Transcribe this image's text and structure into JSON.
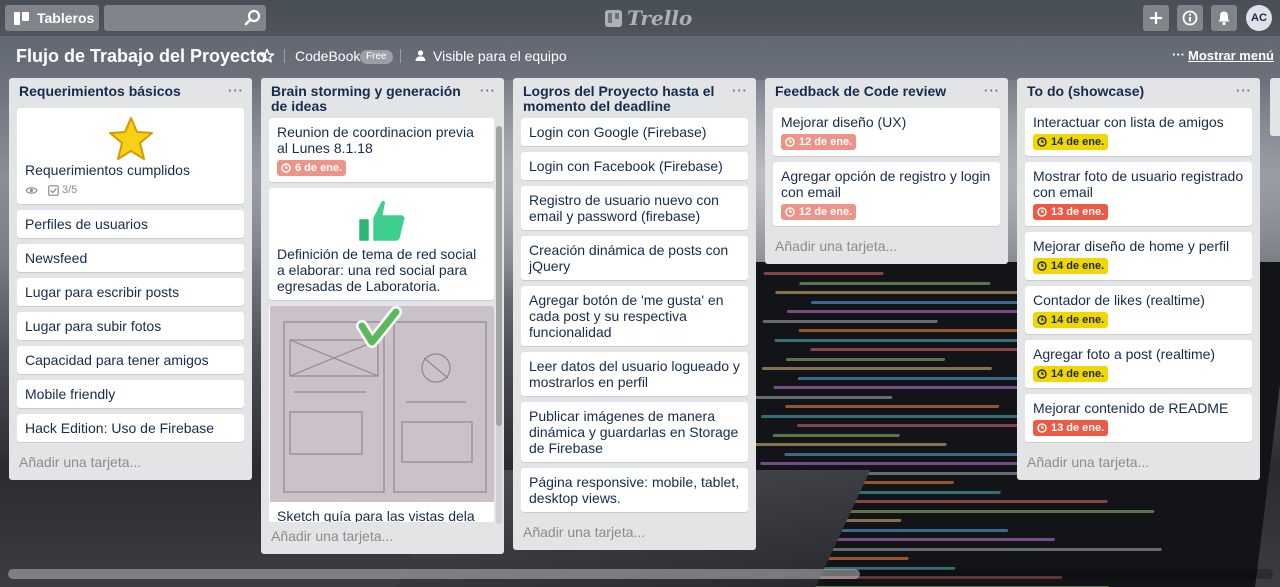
{
  "header": {
    "boards_label": "Tableros",
    "search_value": "",
    "logo_text": "Trello",
    "avatar_initials": "AC"
  },
  "board": {
    "title": "Flujo de Trabajo del Proyecto",
    "team": "CodeBook",
    "team_badge": "Free",
    "visibility": "Visible para el equipo",
    "show_menu": "Mostrar menú"
  },
  "lists": [
    {
      "title": "Requerimientos básicos",
      "add_card": "Añadir una tarjeta...",
      "cards": [
        {
          "title": "Requerimientos cumplidos",
          "cover": "star",
          "checklist": "3/5"
        },
        {
          "title": "Perfiles de usuarios"
        },
        {
          "title": "Newsfeed"
        },
        {
          "title": "Lugar para escribir posts"
        },
        {
          "title": "Lugar para subir fotos"
        },
        {
          "title": "Capacidad para tener amigos"
        },
        {
          "title": "Mobile friendly"
        },
        {
          "title": "Hack Edition: Uso de Firebase"
        }
      ]
    },
    {
      "title": "Brain storming y generación de ideas",
      "add_card": "Añadir una tarjeta...",
      "cards": [
        {
          "title": "Reunion de coordinacion previa al Lunes 8.1.18",
          "due": "6 de ene.",
          "due_color": "pink"
        },
        {
          "title": "Definición de tema de red social a elaborar: una red social para egresadas de Laboratoria.",
          "cover": "thumbs-up"
        },
        {
          "title": "Sketch guía para las vistas dela",
          "cover": "sketch"
        }
      ]
    },
    {
      "title": "Logros del Proyecto hasta el momento del deadline",
      "add_card": "Añadir una tarjeta...",
      "cards": [
        {
          "title": "Login con Google (Firebase)"
        },
        {
          "title": "Login con Facebook (Firebase)"
        },
        {
          "title": "Registro de usuario nuevo con email y password (firebase)"
        },
        {
          "title": "Creación dinámica de posts con jQuery"
        },
        {
          "title": "Agregar botón de 'me gusta' en cada post y su respectiva funcionalidad"
        },
        {
          "title": "Leer datos del usuario logueado y mostrarlos en perfil"
        },
        {
          "title": "Publicar imágenes de manera dinámica y guardarlas en Storage de Firebase"
        },
        {
          "title": "Página responsive: mobile, tablet, desktop views."
        }
      ]
    },
    {
      "title": "Feedback de Code review",
      "add_card": "Añadir una tarjeta...",
      "cards": [
        {
          "title": "Mejorar diseño (UX)",
          "due": "12 de ene.",
          "due_color": "pink"
        },
        {
          "title": "Agregar opción de registro y login con email",
          "due": "12 de ene.",
          "due_color": "pink"
        }
      ]
    },
    {
      "title": "To do (showcase)",
      "add_card": "Añadir una tarjeta...",
      "cards": [
        {
          "title": "Interactuar con lista de amigos",
          "due": "14 de ene.",
          "due_color": "yellow"
        },
        {
          "title": "Mostrar foto de usuario registrado con email",
          "due": "13 de ene.",
          "due_color": "red"
        },
        {
          "title": "Mejorar diseño de home y perfil",
          "due": "14 de ene.",
          "due_color": "yellow"
        },
        {
          "title": "Contador de likes (realtime)",
          "due": "14 de ene.",
          "due_color": "yellow"
        },
        {
          "title": "Agregar foto a post (realtime)",
          "due": "14 de ene.",
          "due_color": "yellow"
        },
        {
          "title": "Mejorar contenido de README",
          "due": "13 de ene.",
          "due_color": "red"
        }
      ]
    }
  ]
}
